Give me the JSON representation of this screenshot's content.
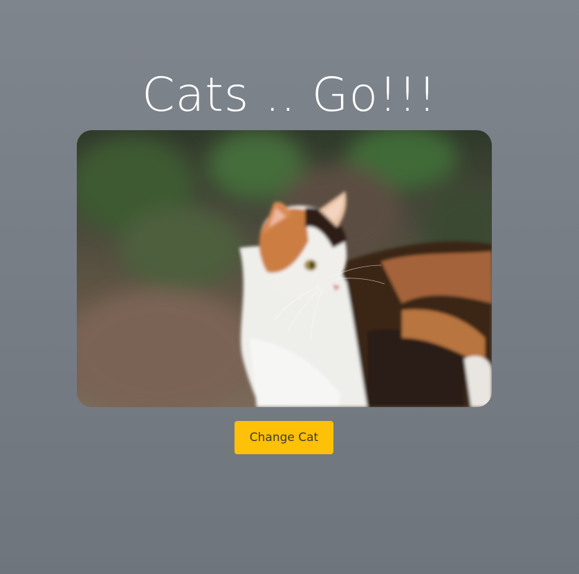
{
  "page": {
    "title": "Cats .. Go!!!"
  },
  "cat_image": {
    "subject": "calico cat",
    "accent_colors": {
      "background_green": "#3c5a34",
      "background_brown": "#6e5d4c",
      "fur_white": "#f2f1ee",
      "fur_orange": "#c77a3e",
      "fur_dark": "#2e1c14"
    }
  },
  "controls": {
    "change_button_label": "Change Cat",
    "change_button_color": "#ffc107"
  }
}
